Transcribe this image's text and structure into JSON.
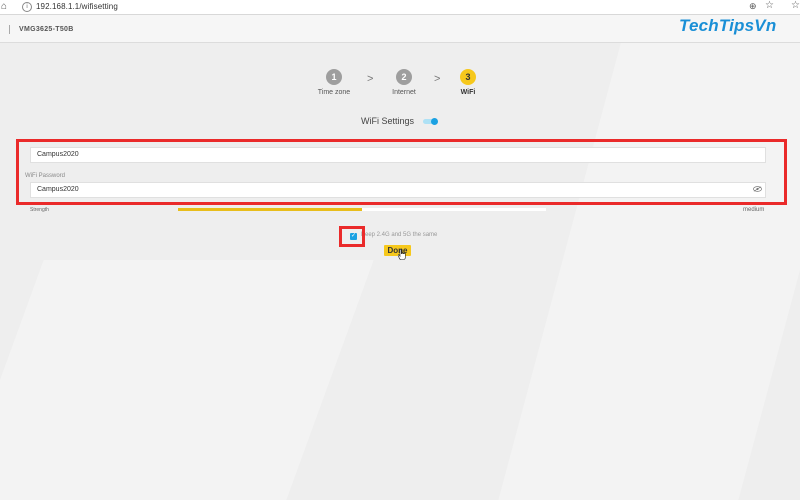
{
  "browser": {
    "url": "192.168.1.1/wifisetting",
    "home_glyph": "⌂",
    "info_glyph": "i",
    "zoom_glyph": "⊕",
    "star_glyph": "☆",
    "fav_glyph": "☆"
  },
  "header": {
    "model": "VMG3625-T50B"
  },
  "watermark": "TechTipsVn",
  "stepper": {
    "steps": [
      {
        "number": "1",
        "label": "Time zone",
        "state": "done"
      },
      {
        "number": "2",
        "label": "Internet",
        "state": "done"
      },
      {
        "number": "3",
        "label": "WiFi",
        "state": "active"
      }
    ],
    "separator": ">"
  },
  "wifi": {
    "title": "WiFi Settings",
    "toggle_on": true,
    "ssid_value": "Campus2020",
    "password_label": "WiFi Password",
    "password_value": "Campus2020",
    "strength_label": "Strength",
    "strength_level": 0.5,
    "strength_text": "medium",
    "keep_same_checked": true,
    "keep_same_label": "Keep 2.4G and 5G the same",
    "check_glyph": "✓",
    "done_label": "Done"
  },
  "colors": {
    "accent": "#1ba1e2",
    "button": "#f6c81c",
    "step_done": "#9e9e9e",
    "step_active": "#f6c81c",
    "highlight": "#ea2a2a",
    "watermark": "#1a8fd6"
  }
}
